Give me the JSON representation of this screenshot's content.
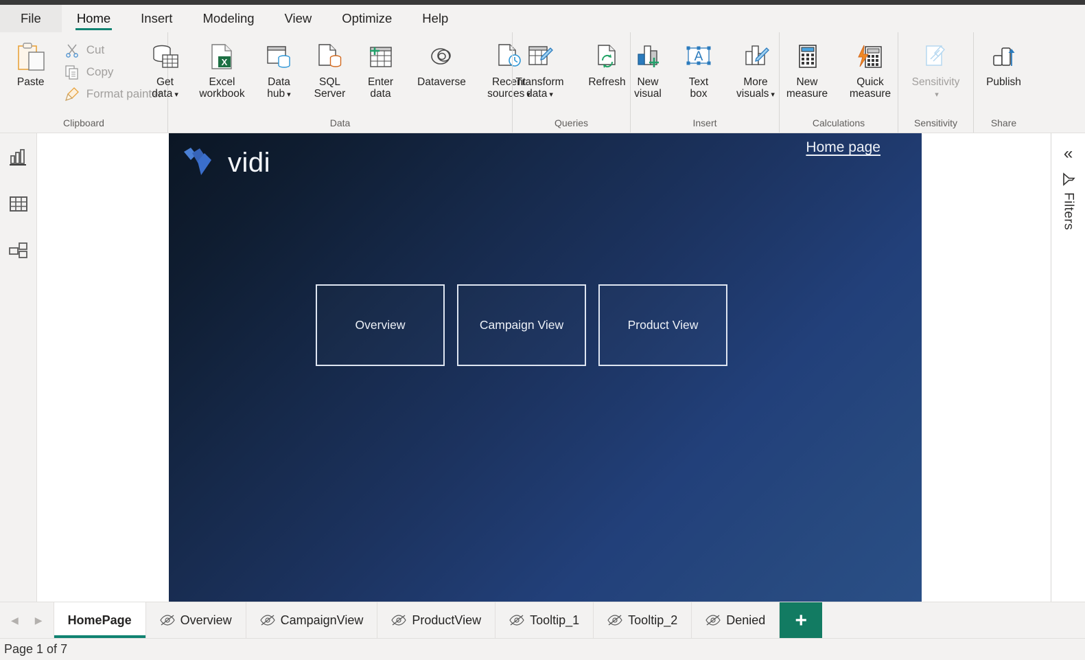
{
  "ribbon": {
    "tabs": [
      {
        "label": "File",
        "active": false
      },
      {
        "label": "Home",
        "active": true
      },
      {
        "label": "Insert",
        "active": false
      },
      {
        "label": "Modeling",
        "active": false
      },
      {
        "label": "View",
        "active": false
      },
      {
        "label": "Optimize",
        "active": false
      },
      {
        "label": "Help",
        "active": false
      }
    ],
    "groups": {
      "clipboard": {
        "label": "Clipboard",
        "paste": "Paste",
        "cut": "Cut",
        "copy": "Copy",
        "format_painter": "Format painter"
      },
      "data": {
        "label": "Data",
        "get_data_1": "Get",
        "get_data_2": "data",
        "excel_1": "Excel",
        "excel_2": "workbook",
        "datahub_1": "Data",
        "datahub_2": "hub",
        "sql_1": "SQL",
        "sql_2": "Server",
        "enter_1": "Enter",
        "enter_2": "data",
        "dataverse": "Dataverse",
        "recent_1": "Recent",
        "recent_2": "sources"
      },
      "queries": {
        "label": "Queries",
        "transform_1": "Transform",
        "transform_2": "data",
        "refresh": "Refresh"
      },
      "insert": {
        "label": "Insert",
        "newvisual_1": "New",
        "newvisual_2": "visual",
        "textbox_1": "Text",
        "textbox_2": "box",
        "morevisuals_1": "More",
        "morevisuals_2": "visuals"
      },
      "calculations": {
        "label": "Calculations",
        "newmeasure_1": "New",
        "newmeasure_2": "measure",
        "quickmeasure_1": "Quick",
        "quickmeasure_2": "measure"
      },
      "sensitivity": {
        "label": "Sensitivity",
        "button": "Sensitivity"
      },
      "share": {
        "label": "Share",
        "publish": "Publish"
      }
    }
  },
  "view_rail": {
    "items": [
      {
        "icon": "report-view-icon",
        "name": "report-view"
      },
      {
        "icon": "data-view-icon",
        "name": "data-view"
      },
      {
        "icon": "model-view-icon",
        "name": "model-view"
      }
    ]
  },
  "canvas": {
    "brand_name": "vidi",
    "home_link": "Home page",
    "nav_buttons": [
      {
        "label": "Overview"
      },
      {
        "label": "Campaign View"
      },
      {
        "label": "Product View"
      }
    ],
    "gradient_from": "#0b1624",
    "gradient_to": "#2a4f86",
    "border_color": "#dfe6f2"
  },
  "filters_pane": {
    "expand_icon": "«",
    "label": "Filters"
  },
  "page_tabs": {
    "prev_arrow": "◀",
    "next_arrow": "▶",
    "add_label": "+",
    "tabs": [
      {
        "label": "HomePage",
        "active": true,
        "hidden": false
      },
      {
        "label": "Overview",
        "active": false,
        "hidden": true
      },
      {
        "label": "CampaignView",
        "active": false,
        "hidden": true
      },
      {
        "label": "ProductView",
        "active": false,
        "hidden": true
      },
      {
        "label": "Tooltip_1",
        "active": false,
        "hidden": true
      },
      {
        "label": "Tooltip_2",
        "active": false,
        "hidden": true
      },
      {
        "label": "Denied",
        "active": false,
        "hidden": true
      }
    ]
  },
  "status_bar": {
    "page_indicator": "Page 1 of 7"
  }
}
